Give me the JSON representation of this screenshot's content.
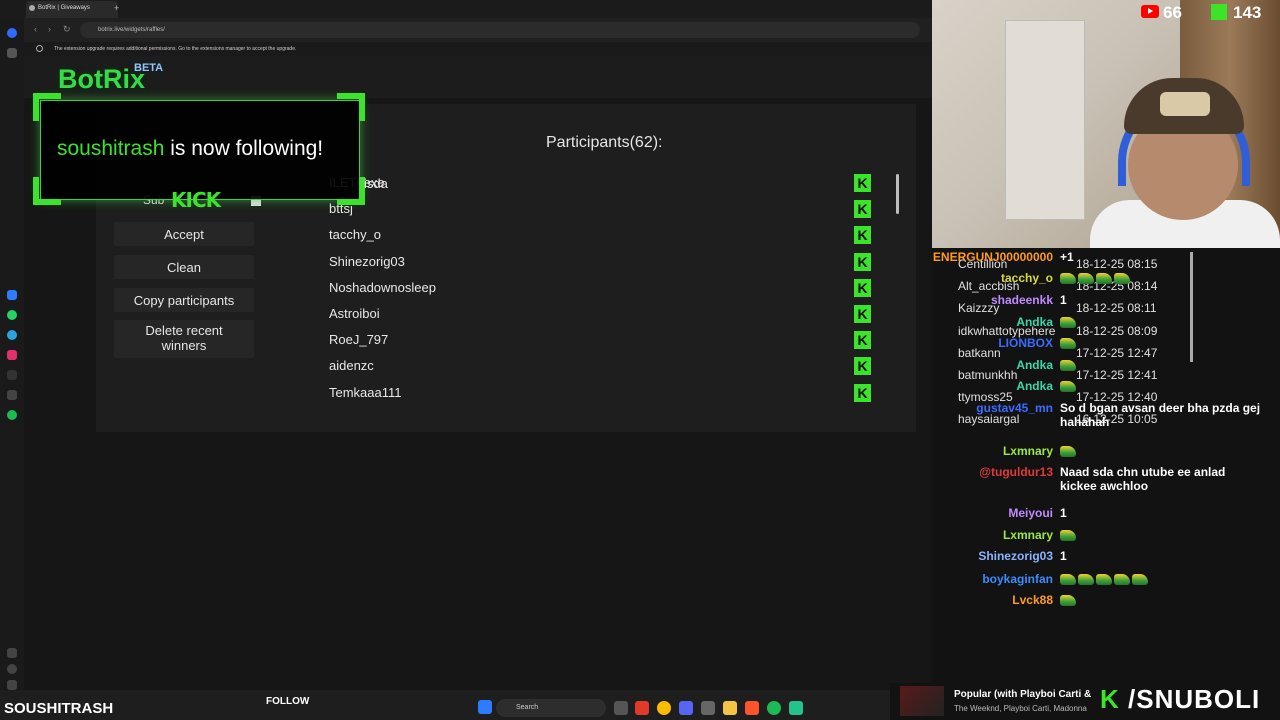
{
  "browser": {
    "tab_title": "BotRix | Giveaways",
    "new_tab": "+",
    "url": "botrix.live/widgets/raffles/",
    "notice": "The extension upgrade requires additional permissions. Go to the extensions manager to accept the upgrade."
  },
  "overlay": {
    "brand": "BotRix",
    "beta": "BETA",
    "follow_user": "soushitrash",
    "follow_text": "is now following!",
    "kick_badge": "KICK",
    "partial_name": "isda"
  },
  "raffle": {
    "sub_label": "Sub",
    "buttons": {
      "accept": "Accept",
      "clean": "Clean",
      "copy": "Copy participants",
      "delete_recent": "Delete recent winners"
    },
    "participants_title": "Participants(62):",
    "participants": [
      "ILET_exe",
      "bttsj",
      "tacchy_o",
      "Shinezorig03",
      "Noshadownosleep",
      "Astroiboi",
      "RoeJ_797",
      "aidenzc",
      "Temkaaa111"
    ],
    "platform_icon_letter": "K"
  },
  "stats": {
    "youtube": "66",
    "kick": "143"
  },
  "recent_winners": [
    {
      "name": "Centillion",
      "time": "18-12-25 08:15"
    },
    {
      "name": "Alt_accbish",
      "time": "18-12-25 08:14"
    },
    {
      "name": "Kaizzzy",
      "time": "18-12-25 08:11"
    },
    {
      "name": "idkwhattotypehere",
      "time": "18-12-25 08:09"
    },
    {
      "name": "batkann",
      "time": "17-12-25 12:47"
    },
    {
      "name": "batmunkhh",
      "time": "17-12-25 12:41"
    },
    {
      "name": "ttymoss25",
      "time": "17-12-25 12:40"
    },
    {
      "name": "haysaiargal",
      "time": "16-12-25 10:05"
    }
  ],
  "chat": [
    {
      "user": "ENERGUNJ00000000",
      "msg": "+1",
      "color": "#ff9a1f",
      "emotes": 0
    },
    {
      "user": "tacchy_o",
      "msg": "",
      "color": "#d9d93a",
      "emotes": 4
    },
    {
      "user": "shadeenkk",
      "msg": "1",
      "color": "#c08aff",
      "emotes": 0
    },
    {
      "user": "Andka",
      "msg": "",
      "color": "#3dd6a8",
      "emotes": 1
    },
    {
      "user": "LIONBOX",
      "msg": "",
      "color": "#3a6cff",
      "emotes": 1
    },
    {
      "user": "Andka",
      "msg": "",
      "color": "#3dd6a8",
      "emotes": 1
    },
    {
      "user": "Andka",
      "msg": "",
      "color": "#3dd6a8",
      "emotes": 1
    },
    {
      "user": "gustav45_mn",
      "msg": "So d bgan avsan deer bha pzda gej hahahah",
      "color": "#3a6cff",
      "emotes": 0
    },
    {
      "user": "Lxmnary",
      "msg": "",
      "color": "#9be84a",
      "emotes": 1
    },
    {
      "user": "@tuguldur13",
      "msg": "Naad sda chn utube ee anlad kickee awchloo",
      "color": "#e03a3a",
      "emotes": 0
    },
    {
      "user": "Meiyoui",
      "msg": "1",
      "color": "#c08aff",
      "emotes": 0
    },
    {
      "user": "Lxmnary",
      "msg": "",
      "color": "#9be84a",
      "emotes": 1
    },
    {
      "user": "Shinezorig03",
      "msg": "1",
      "color": "#8ab4ff",
      "emotes": 0
    },
    {
      "user": "boykaginfan",
      "msg": "",
      "color": "#3a8cff",
      "emotes": 5
    },
    {
      "user": "Lvck88",
      "msg": "",
      "color": "#ff9a1f",
      "emotes": 1
    }
  ],
  "bottom": {
    "streamer": "SOUSHITRASH",
    "follow": "FOLLOW",
    "search": "Search",
    "music_title": "Popular (with Playboi Carti & Madonna)",
    "music_artist": "The Weeknd, Playboi Carti, Madonna",
    "kick_handle": "/SNUBOLI",
    "kick_letter": "K"
  }
}
